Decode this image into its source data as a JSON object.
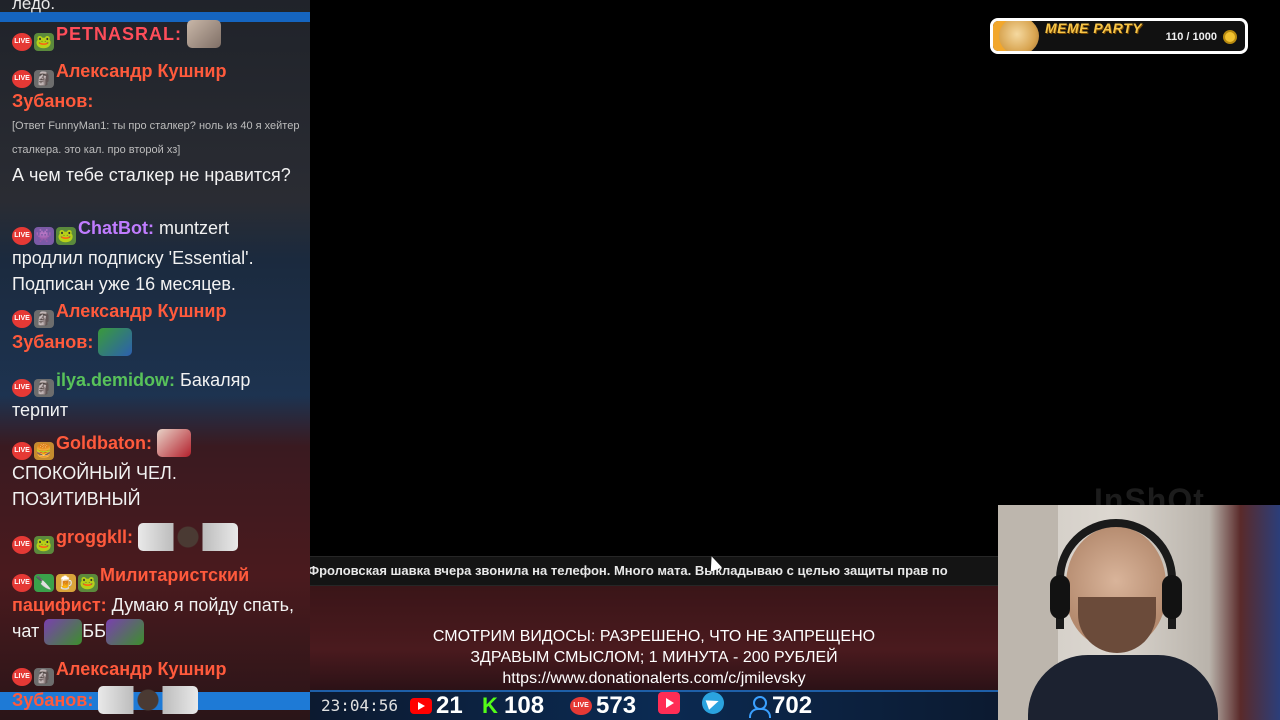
{
  "chat": {
    "cut_line": "ледо.",
    "messages": [
      {
        "nick": "PETNASRAL:",
        "nick_color": "#ff4d5a",
        "text": "",
        "badges": [
          "live",
          "frog"
        ],
        "sticker": "face"
      },
      {
        "nick": "Александр Кушнир Зубанов:",
        "nick_color": "#ff5a3c",
        "reply": "[Ответ FunnyMan1: ты про сталкер? ноль из 40 я хейтер сталкера. это кал. про второй хз]",
        "text": "А чем тебе сталкер не нравится?",
        "badges": [
          "live",
          "face"
        ]
      },
      {
        "nick": "ChatBot:",
        "nick_color": "#c07cff",
        "text": " muntzert продлил подписку 'Essential'. Подписан уже 16 месяцев.",
        "badges": [
          "live",
          "robot",
          "frog"
        ]
      },
      {
        "nick": "Александр Кушнир Зубанов:",
        "nick_color": "#ff5a3c",
        "text": "",
        "badges": [
          "live",
          "face"
        ],
        "sticker": "green"
      },
      {
        "nick": "ilya.demidow:",
        "nick_color": "#58c25a",
        "text": " Бакаляр терпит",
        "badges": [
          "live",
          "face"
        ]
      },
      {
        "nick": "Goldbaton:",
        "nick_color": "#ff5a3c",
        "text": "СПОКОЙНЫЙ ЧЕЛ. ПОЗИТИВНЫЙ",
        "badges": [
          "live",
          "burger"
        ],
        "sticker": "red"
      },
      {
        "nick": "groggkll:",
        "nick_color": "#ff5a3c",
        "text": "",
        "badges": [
          "live",
          "frog"
        ],
        "sticker": "wings"
      },
      {
        "nick": "Милитаристский пацифист:",
        "nick_color": "#ff5a3c",
        "text": " Думаю я пойду спать, чат",
        "badges": [
          "live",
          "knife",
          "beer",
          "frog"
        ],
        "trail": "ББ"
      },
      {
        "nick": "Александр Кушнир Зубанов:",
        "nick_color": "#ff5a3c",
        "text": "",
        "badges": [
          "live",
          "face"
        ],
        "sticker": "wings"
      }
    ]
  },
  "meme_party": {
    "title": "MEME PARTY",
    "progress_text": "110 / 1000",
    "progress_fraction": 0.11
  },
  "watermark": "InShOt",
  "ticker": {
    "text": "Фроловская шавка вчера звонила на телефон. Много мата. Выкладываю с целью защиты прав по"
  },
  "rules": {
    "line1": "СМОТРИМ ВИДОСЫ: РАЗРЕШЕНО, ЧТО НЕ ЗАПРЕЩЕНО",
    "line2": "ЗДРАВЫМ СМЫСЛОМ; 1 МИНУТА - 200 РУБЛЕЙ",
    "line3": "https://www.donationalerts.com/c/jmilevsky"
  },
  "status": {
    "clock": "23:04:56",
    "youtube_viewers": "21",
    "kick_viewers": "108",
    "vk_live_viewers": "573",
    "total_viewers": "702"
  },
  "colors": {
    "accent_blue": "#1565c0",
    "kick_green": "#53fc18",
    "youtube_red": "#ff0000"
  }
}
